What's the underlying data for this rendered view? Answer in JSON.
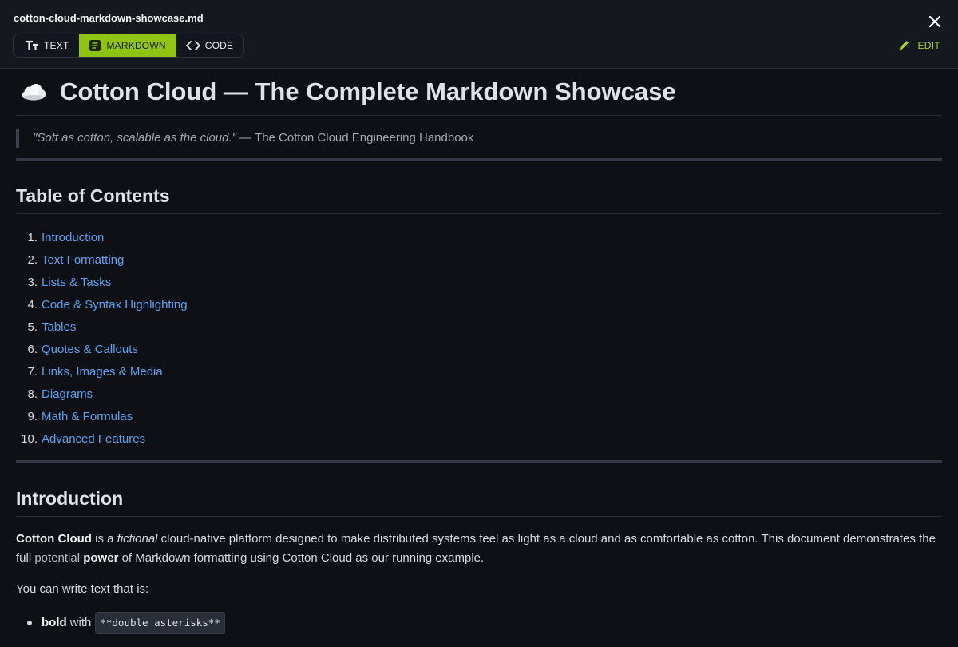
{
  "window": {
    "filename": "cotton-cloud-markdown-showcase.md",
    "close_icon": "close-icon"
  },
  "tabs": [
    {
      "label": "TEXT",
      "icon": "text-format-icon",
      "active": false
    },
    {
      "label": "MARKDOWN",
      "icon": "document-icon",
      "active": true
    },
    {
      "label": "CODE",
      "icon": "code-brackets-icon",
      "active": false
    }
  ],
  "edit": {
    "label": "EDIT",
    "icon": "pencil-icon"
  },
  "colors": {
    "accent": "#8fc314",
    "link": "#5aa2f0",
    "background": "#0e1016"
  },
  "doc": {
    "title_icon": "cloud-icon",
    "title": "Cotton Cloud — The Complete Markdown Showcase",
    "quote_italic": "\"Soft as cotton, scalable as the cloud.\"",
    "quote_attribution": " — The Cotton Cloud Engineering Handbook",
    "toc_heading": "Table of Contents",
    "toc": [
      {
        "num": "1.",
        "label": "Introduction"
      },
      {
        "num": "2.",
        "label": "Text Formatting"
      },
      {
        "num": "3.",
        "label": "Lists & Tasks"
      },
      {
        "num": "4.",
        "label": "Code & Syntax Highlighting"
      },
      {
        "num": "5.",
        "label": "Tables"
      },
      {
        "num": "6.",
        "label": "Quotes & Callouts"
      },
      {
        "num": "7.",
        "label": "Links, Images & Media"
      },
      {
        "num": "8.",
        "label": "Diagrams"
      },
      {
        "num": "9.",
        "label": "Math & Formulas"
      },
      {
        "num": "10.",
        "label": "Advanced Features"
      }
    ],
    "intro_heading": "Introduction",
    "intro": {
      "bold_name": "Cotton Cloud",
      "text1": " is a ",
      "italic": "fictional",
      "text2": " cloud-native platform designed to make distributed systems feel as light as a cloud and as comfortable as cotton. This document demonstrates the full ",
      "strike": "potential",
      "space": " ",
      "bold2": "power",
      "text3": " of Markdown formatting using Cotton Cloud as our running example."
    },
    "can_write": "You can write text that is:",
    "formats": [
      {
        "bold": "bold",
        "text": "with",
        "code": "**double asterisks**"
      }
    ]
  }
}
